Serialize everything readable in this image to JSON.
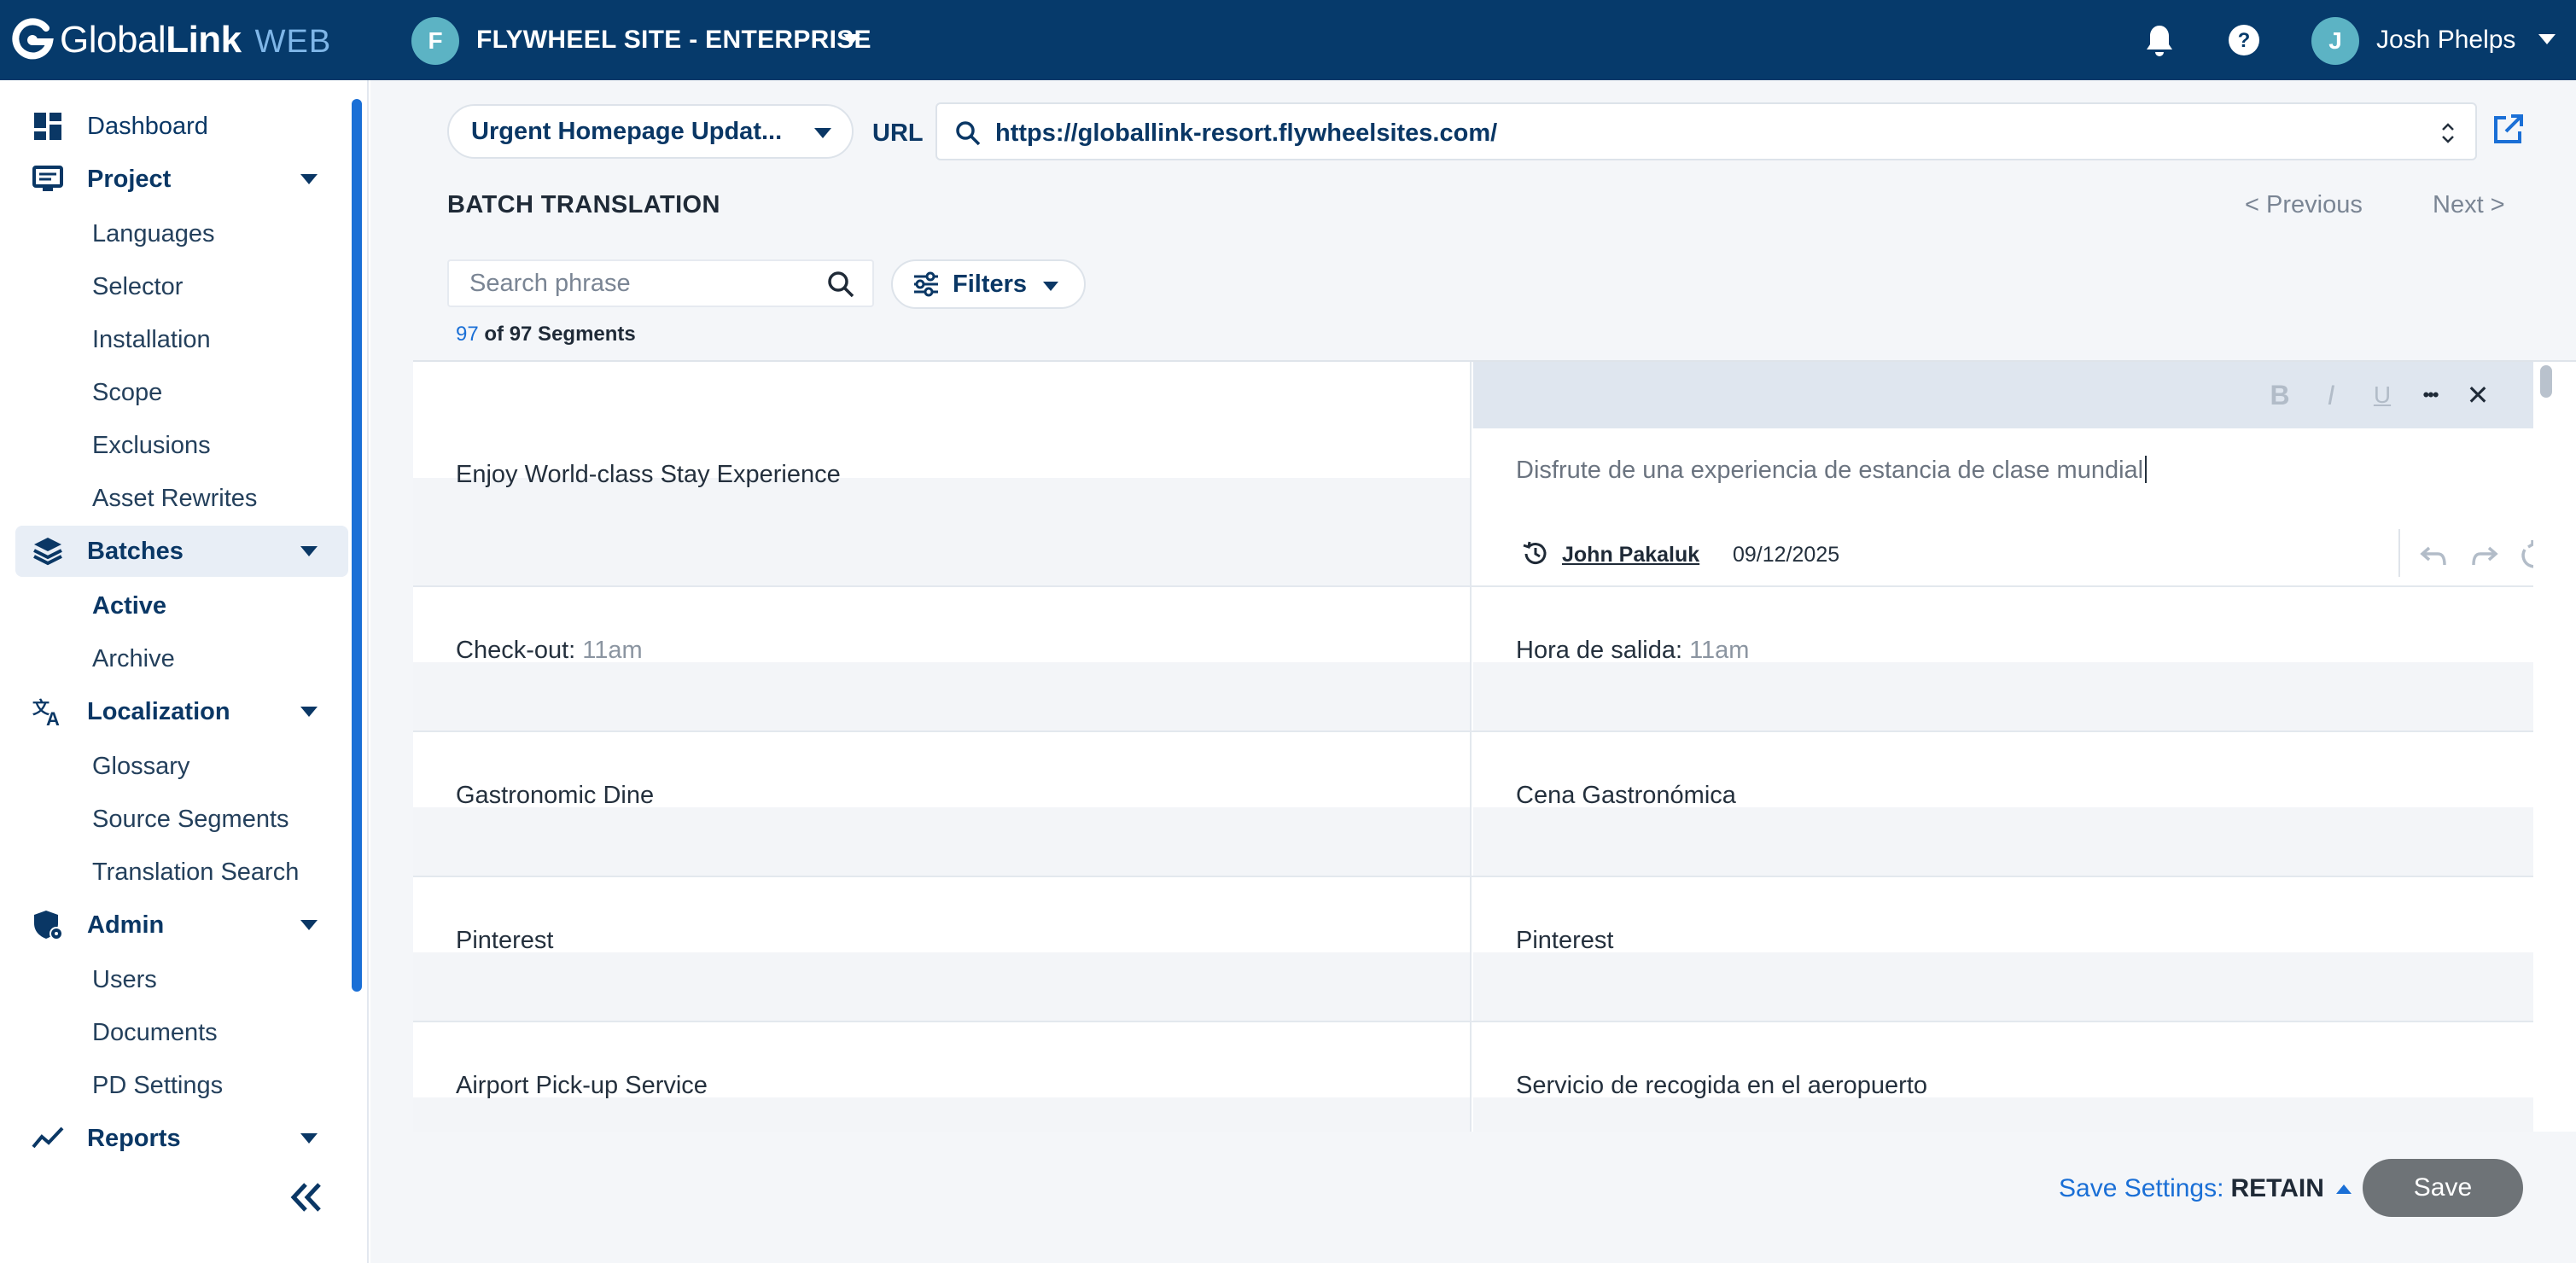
{
  "app": {
    "logo_primary": "Global",
    "logo_bold": "Link",
    "logo_suffix": "WEB",
    "site_initial": "F",
    "site_name": "FLYWHEEL SITE - ENTERPRISE",
    "user_initial": "J",
    "user_name": "Josh Phelps",
    "brand_color": "#063a6b",
    "accent_color": "#1a6fd6"
  },
  "sidebar": {
    "dashboard": "Dashboard",
    "project": "Project",
    "project_items": [
      "Languages",
      "Selector",
      "Installation",
      "Scope",
      "Exclusions",
      "Asset Rewrites"
    ],
    "batches": "Batches",
    "batches_items": [
      "Active",
      "Archive"
    ],
    "localization": "Localization",
    "localization_items": [
      "Glossary",
      "Source Segments",
      "Translation Search"
    ],
    "admin": "Admin",
    "admin_items": [
      "Users",
      "Documents",
      "PD Settings"
    ],
    "reports": "Reports"
  },
  "toolbar": {
    "batch_name": "Urgent Homepage Updat...",
    "url_label": "URL",
    "url_value": "https://globallink-resort.flywheelsites.com/"
  },
  "section": {
    "title": "BATCH TRANSLATION",
    "previous": "< Previous",
    "next": "Next >",
    "search_placeholder": "Search phrase",
    "filters": "Filters",
    "count_shown": "97",
    "count_rest": " of 97 Segments"
  },
  "editor": {
    "bold": "B",
    "italic": "I",
    "underline": "U",
    "more": "•••",
    "close": "✕",
    "user": "John Pakaluk",
    "date": "09/12/2025"
  },
  "segments": [
    {
      "source": "Enjoy World-class Stay Experience",
      "target": "Disfrute de una experiencia de estancia de clase mundial"
    },
    {
      "source": "Check-out:",
      "source_value": "11am",
      "target": "Hora de salida:",
      "target_value": "11am"
    },
    {
      "source": "Gastronomic Dine",
      "target": "Cena Gastronómica"
    },
    {
      "source": "Pinterest",
      "target": "Pinterest"
    },
    {
      "source": "Airport Pick-up Service",
      "target": "Servicio de recogida en el aeropuerto"
    }
  ],
  "footer": {
    "save_settings_label": "Save Settings:",
    "save_settings_value": "RETAIN",
    "save_label": "Save"
  }
}
